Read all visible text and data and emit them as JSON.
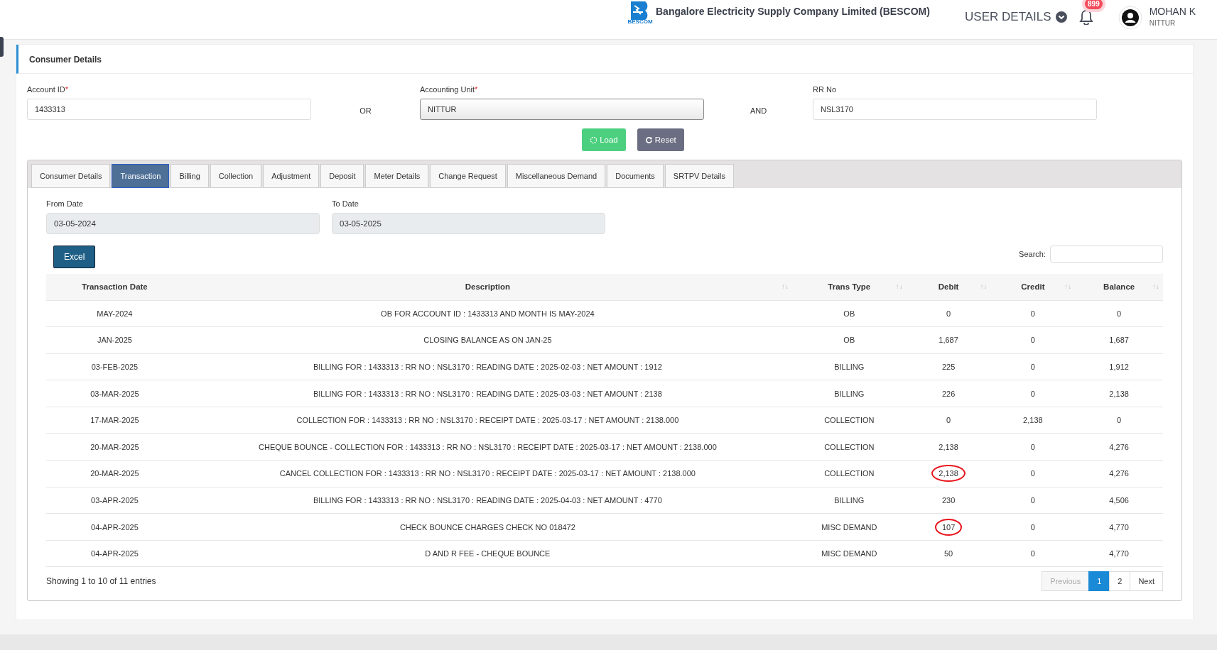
{
  "header": {
    "company": "Bangalore Electricity Supply Company Limited (BESCOM)",
    "logo_caption": "BESCOM",
    "user_details": "USER DETAILS",
    "notification_count": "899",
    "user_name": "MOHAN K",
    "user_unit": "NITTUR"
  },
  "card": {
    "title": "Consumer Details"
  },
  "form": {
    "fields": [
      {
        "label": "Account ID",
        "required_mark": "*",
        "value": "1433313",
        "kind": "input"
      },
      {
        "kind": "joiner",
        "label": "OR"
      },
      {
        "label": "Accounting Unit",
        "required_mark": "*",
        "value": "NITTUR",
        "kind": "select"
      },
      {
        "kind": "joiner",
        "label": "AND"
      },
      {
        "label": "RR No",
        "value": "NSL3170",
        "kind": "input"
      }
    ],
    "buttons": [
      {
        "label": "Load",
        "kind": "load"
      },
      {
        "label": "Reset",
        "kind": "reset"
      }
    ]
  },
  "tabs": [
    {
      "label": "Consumer Details",
      "selected": false
    },
    {
      "label": "Transaction",
      "selected": true
    },
    {
      "label": "Billing",
      "selected": false
    },
    {
      "label": "Collection",
      "selected": false
    },
    {
      "label": "Adjustment",
      "selected": false
    },
    {
      "label": "Deposit",
      "selected": false
    },
    {
      "label": "Meter Details",
      "selected": false
    },
    {
      "label": "Change Request",
      "selected": false
    },
    {
      "label": "Miscellaneous Demand",
      "selected": false
    },
    {
      "label": "Documents",
      "selected": false
    },
    {
      "label": "SRTPV Details",
      "selected": false
    }
  ],
  "dates": [
    {
      "label": "From Date",
      "value": "03-05-2024"
    },
    {
      "label": "To Date",
      "value": "03-05-2025"
    }
  ],
  "excel_button": "Excel",
  "search": {
    "label": "Search:"
  },
  "table": {
    "columns": [
      {
        "label": "Transaction Date"
      },
      {
        "label": "Description",
        "sort_icon": "↑↓"
      },
      {
        "label": "Trans Type",
        "sort_icon": "↑↓"
      },
      {
        "label": "Debit",
        "sort_icon": "↑↓"
      },
      {
        "label": "Credit",
        "sort_icon": "↑↓"
      },
      {
        "label": "Balance",
        "sort_icon": "↑↓"
      }
    ],
    "rows": [
      {
        "date": "MAY-2024",
        "description": "OB FOR ACCOUNT ID : 1433313 AND MONTH IS MAY-2024",
        "type": "OB",
        "debit": "0",
        "credit": "0",
        "balance": "0",
        "debit_circled": false
      },
      {
        "date": "JAN-2025",
        "description": "CLOSING BALANCE AS ON JAN-25",
        "type": "OB",
        "debit": "1,687",
        "credit": "0",
        "balance": "1,687",
        "debit_circled": false
      },
      {
        "date": "03-FEB-2025",
        "description": "BILLING FOR : 1433313 : RR NO : NSL3170 : READING DATE : 2025-02-03 : NET AMOUNT : 1912",
        "type": "BILLING",
        "debit": "225",
        "credit": "0",
        "balance": "1,912",
        "debit_circled": false
      },
      {
        "date": "03-MAR-2025",
        "description": "BILLING FOR : 1433313 : RR NO : NSL3170 : READING DATE : 2025-03-03 : NET AMOUNT : 2138",
        "type": "BILLING",
        "debit": "226",
        "credit": "0",
        "balance": "2,138",
        "debit_circled": false
      },
      {
        "date": "17-MAR-2025",
        "description": "COLLECTION FOR : 1433313 : RR NO : NSL3170 : RECEIPT DATE : 2025-03-17 : NET AMOUNT : 2138.000",
        "type": "COLLECTION",
        "debit": "0",
        "credit": "2,138",
        "balance": "0",
        "debit_circled": false
      },
      {
        "date": "20-MAR-2025",
        "description": "CHEQUE BOUNCE - COLLECTION FOR : 1433313 : RR NO : NSL3170 : RECEIPT DATE : 2025-03-17 : NET AMOUNT : 2138.000",
        "type": "COLLECTION",
        "debit": "2,138",
        "credit": "0",
        "balance": "4,276",
        "debit_circled": false
      },
      {
        "date": "20-MAR-2025",
        "description": "CANCEL COLLECTION FOR : 1433313 : RR NO : NSL3170 : RECEIPT DATE : 2025-03-17 : NET AMOUNT : 2138.000",
        "type": "COLLECTION",
        "debit": "2,138",
        "credit": "0",
        "balance": "4,276",
        "debit_circled": true
      },
      {
        "date": "03-APR-2025",
        "description": "BILLING FOR : 1433313 : RR NO : NSL3170 : READING DATE : 2025-04-03 : NET AMOUNT : 4770",
        "type": "BILLING",
        "debit": "230",
        "credit": "0",
        "balance": "4,506",
        "debit_circled": false
      },
      {
        "date": "04-APR-2025",
        "description": "CHECK BOUNCE CHARGES CHECK NO 018472",
        "type": "MISC DEMAND",
        "debit": "107",
        "credit": "0",
        "balance": "4,770",
        "debit_circled": true
      },
      {
        "date": "04-APR-2025",
        "description": "D AND R FEE - CHEQUE BOUNCE",
        "type": "MISC DEMAND",
        "debit": "50",
        "credit": "0",
        "balance": "4,770",
        "debit_circled": false
      }
    ]
  },
  "entries_info": "Showing 1 to 10 of 11 entries",
  "pagination": [
    {
      "label": "Previous",
      "disabled": true,
      "selected": false
    },
    {
      "label": "1",
      "disabled": false,
      "selected": true
    },
    {
      "label": "2",
      "disabled": false,
      "selected": false
    },
    {
      "label": "Next",
      "disabled": false,
      "selected": false
    }
  ]
}
